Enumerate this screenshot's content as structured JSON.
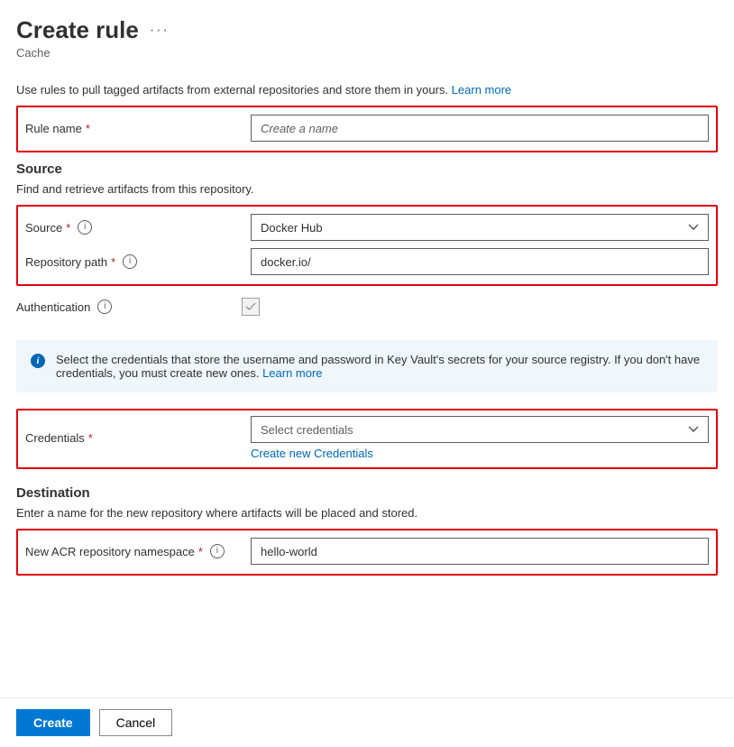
{
  "header": {
    "title": "Create rule",
    "subtitle": "Cache"
  },
  "intro": {
    "text": "Use rules to pull tagged artifacts from external repositories and store them in yours. ",
    "learn_more": "Learn more"
  },
  "rule_name": {
    "label": "Rule name",
    "placeholder": "Create a name",
    "value": ""
  },
  "source_section": {
    "title": "Source",
    "description": "Find and retrieve artifacts from this repository.",
    "source": {
      "label": "Source",
      "value": "Docker Hub"
    },
    "repo_path": {
      "label": "Repository path",
      "value": "docker.io/"
    },
    "auth": {
      "label": "Authentication"
    }
  },
  "info_banner": {
    "text": "Select the credentials that store the username and password in Key Vault's secrets for your source registry. If you don't have credentials, you must create new ones. ",
    "learn_more": "Learn more"
  },
  "credentials": {
    "label": "Credentials",
    "placeholder": "Select credentials",
    "create_link": "Create new Credentials"
  },
  "destination": {
    "title": "Destination",
    "description": "Enter a name for the new repository where artifacts will be placed and stored.",
    "namespace": {
      "label": "New ACR repository namespace",
      "value": "hello-world"
    }
  },
  "footer": {
    "create": "Create",
    "cancel": "Cancel"
  }
}
